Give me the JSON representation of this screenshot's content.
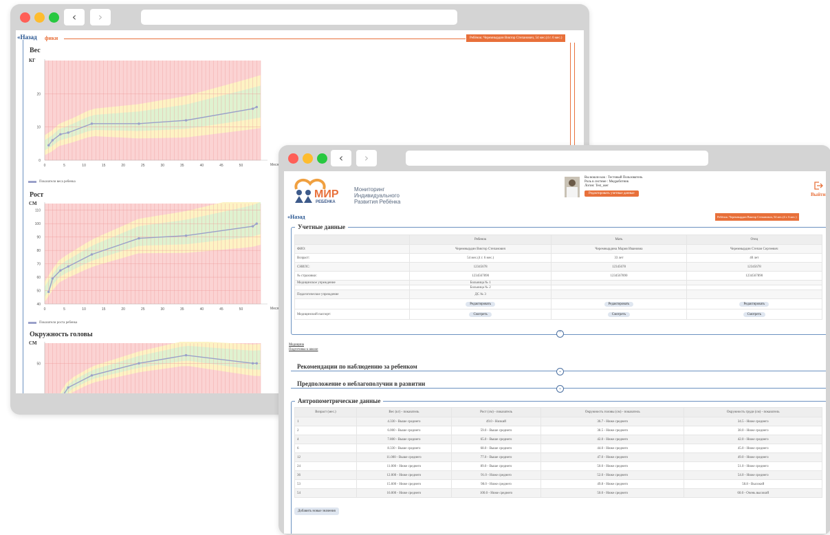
{
  "window1": {
    "back_label": "Назад",
    "header_partial": "фики",
    "child_badge": "Ребёнок: Черемнырдин Виктор Степанович, 54 мес.(4 г. 6 мес.)",
    "charts": [
      {
        "title": "Вес",
        "unit": "КГ",
        "xlabel": "Месяц",
        "legend": "Показатели веса ребенка"
      },
      {
        "title": "Рост",
        "unit": "СМ",
        "xlabel": "Месяц",
        "legend": "Показатели роста ребенка"
      },
      {
        "title": "Окружность головы",
        "unit": "СМ"
      }
    ]
  },
  "chart_data": [
    {
      "type": "line",
      "title": "Вес",
      "ylabel": "КГ",
      "xlabel": "Месяц",
      "xlim": [
        0,
        55
      ],
      "ylim": [
        0,
        30
      ],
      "x_ticks": [
        0,
        5,
        10,
        15,
        20,
        25,
        30,
        35,
        40,
        45,
        50
      ],
      "y_ticks": [
        0,
        10,
        20
      ],
      "series": [
        {
          "name": "Показатели веса ребенка",
          "x": [
            1,
            2,
            4,
            6,
            12,
            24,
            36,
            53,
            54
          ],
          "y": [
            4.5,
            6,
            7.8,
            8.3,
            11,
            11,
            12,
            15.5,
            16
          ]
        }
      ]
    },
    {
      "type": "line",
      "title": "Рост",
      "ylabel": "СМ",
      "xlabel": "Месяц",
      "xlim": [
        0,
        55
      ],
      "ylim": [
        40,
        115
      ],
      "x_ticks": [
        0,
        5,
        10,
        15,
        20,
        25,
        30,
        35,
        40,
        45,
        50
      ],
      "y_ticks": [
        40,
        50,
        60,
        70,
        80,
        90,
        100,
        110
      ],
      "series": [
        {
          "name": "Показатели роста ребенка",
          "x": [
            1,
            2,
            4,
            6,
            12,
            24,
            36,
            53,
            54
          ],
          "y": [
            49,
            59,
            65,
            68,
            77,
            89,
            91,
            98,
            100
          ]
        }
      ]
    },
    {
      "type": "line",
      "title": "Окружность головы",
      "ylabel": "СМ",
      "xlim": [
        0,
        55
      ],
      "ylim": [
        40,
        55
      ],
      "y_ticks": [
        50
      ],
      "series": [
        {
          "x": [
            1,
            6,
            12,
            24,
            36,
            53,
            54
          ],
          "y": [
            36.7,
            44,
            47,
            50,
            52,
            50,
            50
          ]
        }
      ]
    }
  ],
  "window2": {
    "logo": {
      "brand": "МИР",
      "sub": "РЕБЁНКА",
      "line1": "Мониторинг",
      "line2": "Индивидуального",
      "line3": "Развития Ребёнка"
    },
    "user": {
      "line1": "Вы вошли как : Тестовый Пользователь",
      "line2": "Роль в системе : Медработник",
      "line3": "Логин: Test_user",
      "edit_button": "Редактировать учетные данные"
    },
    "exit_label": "Выйти",
    "back_label": "Назад",
    "child_badge": "Ребёнок: Черемнырдин Виктор Степанович, 54 мес.(4 г. 6 мес.)",
    "accounts": {
      "title": "Учетные данные",
      "headers": [
        "",
        "Ребенок",
        "Мать",
        "Отец"
      ],
      "rows": [
        [
          "ФИО:",
          "Черемнырдин Виктор Степанович",
          "Черемнырдина Мария Ивановна",
          "Черемнырдин Степан Сергеевич"
        ],
        [
          "Возраст:",
          "54 мес.(4 г. 6 мес.)",
          "33 лет",
          "40 лет"
        ],
        [
          "СНИЛС:",
          "12345678",
          "12345678",
          "12345678"
        ],
        [
          "№ страховки:",
          "1234567890",
          "1234567890",
          "1234567890"
        ],
        [
          "Медицинское учреждение",
          "Больница № 1",
          "",
          ""
        ],
        [
          "",
          "Больница № 2",
          "",
          ""
        ],
        [
          "Педагогическое учреждение",
          "ДС № 3",
          "",
          ""
        ]
      ],
      "edit_label": "Редактировать",
      "medpass_label": "Медицинский паспорт:",
      "view_label": "Смотреть"
    },
    "links": [
      "Медицина",
      "Подготовка к школе"
    ],
    "section_recommendations": "Рекомендации по наблюдению за ребенком",
    "section_trouble": "Предположение о неблагополучии в развитии",
    "anthropometry": {
      "title": "Антропометрические данные",
      "headers": [
        "Возраст (мес.)",
        "Вес (кг) - показатель",
        "Рост (см) - показатель",
        "Окружность головы (см) - показатель",
        "Окружность груди (см) - показатель"
      ],
      "rows": [
        [
          "1",
          "4.330 - Выше среднего",
          "49.0 - Низкий",
          "36.7 - Ниже среднего",
          "34.5 - Ниже среднего"
        ],
        [
          "2",
          "6.000 - Выше среднего",
          "59.0 - Выше среднего",
          "38.5 - Ниже среднего",
          "38.0 - Ниже среднего"
        ],
        [
          "4",
          "7.800 - Выше среднего",
          "65.0 - Выше среднего",
          "42.0 - Ниже среднего",
          "42.0 - Ниже среднего"
        ],
        [
          "6",
          "8.330 - Выше среднего",
          "68.0 - Выше среднего",
          "44.0 - Ниже среднего",
          "45.0 - Ниже среднего"
        ],
        [
          "12",
          "11.000 - Выше среднего",
          "77.0 - Выше среднего",
          "47.0 - Ниже среднего",
          "49.0 - Ниже среднего"
        ],
        [
          "24",
          "11.000 - Ниже среднего",
          "89.0 - Выше среднего",
          "50.0 - Ниже среднего",
          "51.0 - Ниже среднего"
        ],
        [
          "36",
          "12.000 - Ниже среднего",
          "91.0 - Ниже среднего",
          "52.0 - Ниже среднего",
          "54.0 - Ниже среднего"
        ],
        [
          "53",
          "15.600 - Ниже среднего",
          "98.0 - Ниже среднего",
          "49.8 - Ниже среднего",
          "58.8 - Высокий"
        ],
        [
          "54",
          "16.000 - Ниже среднего",
          "100.0 - Ниже среднего",
          "50.0 - Ниже среднего",
          "60.0 - Очень высокий"
        ]
      ],
      "add_button": "Добавить новые значения"
    }
  }
}
